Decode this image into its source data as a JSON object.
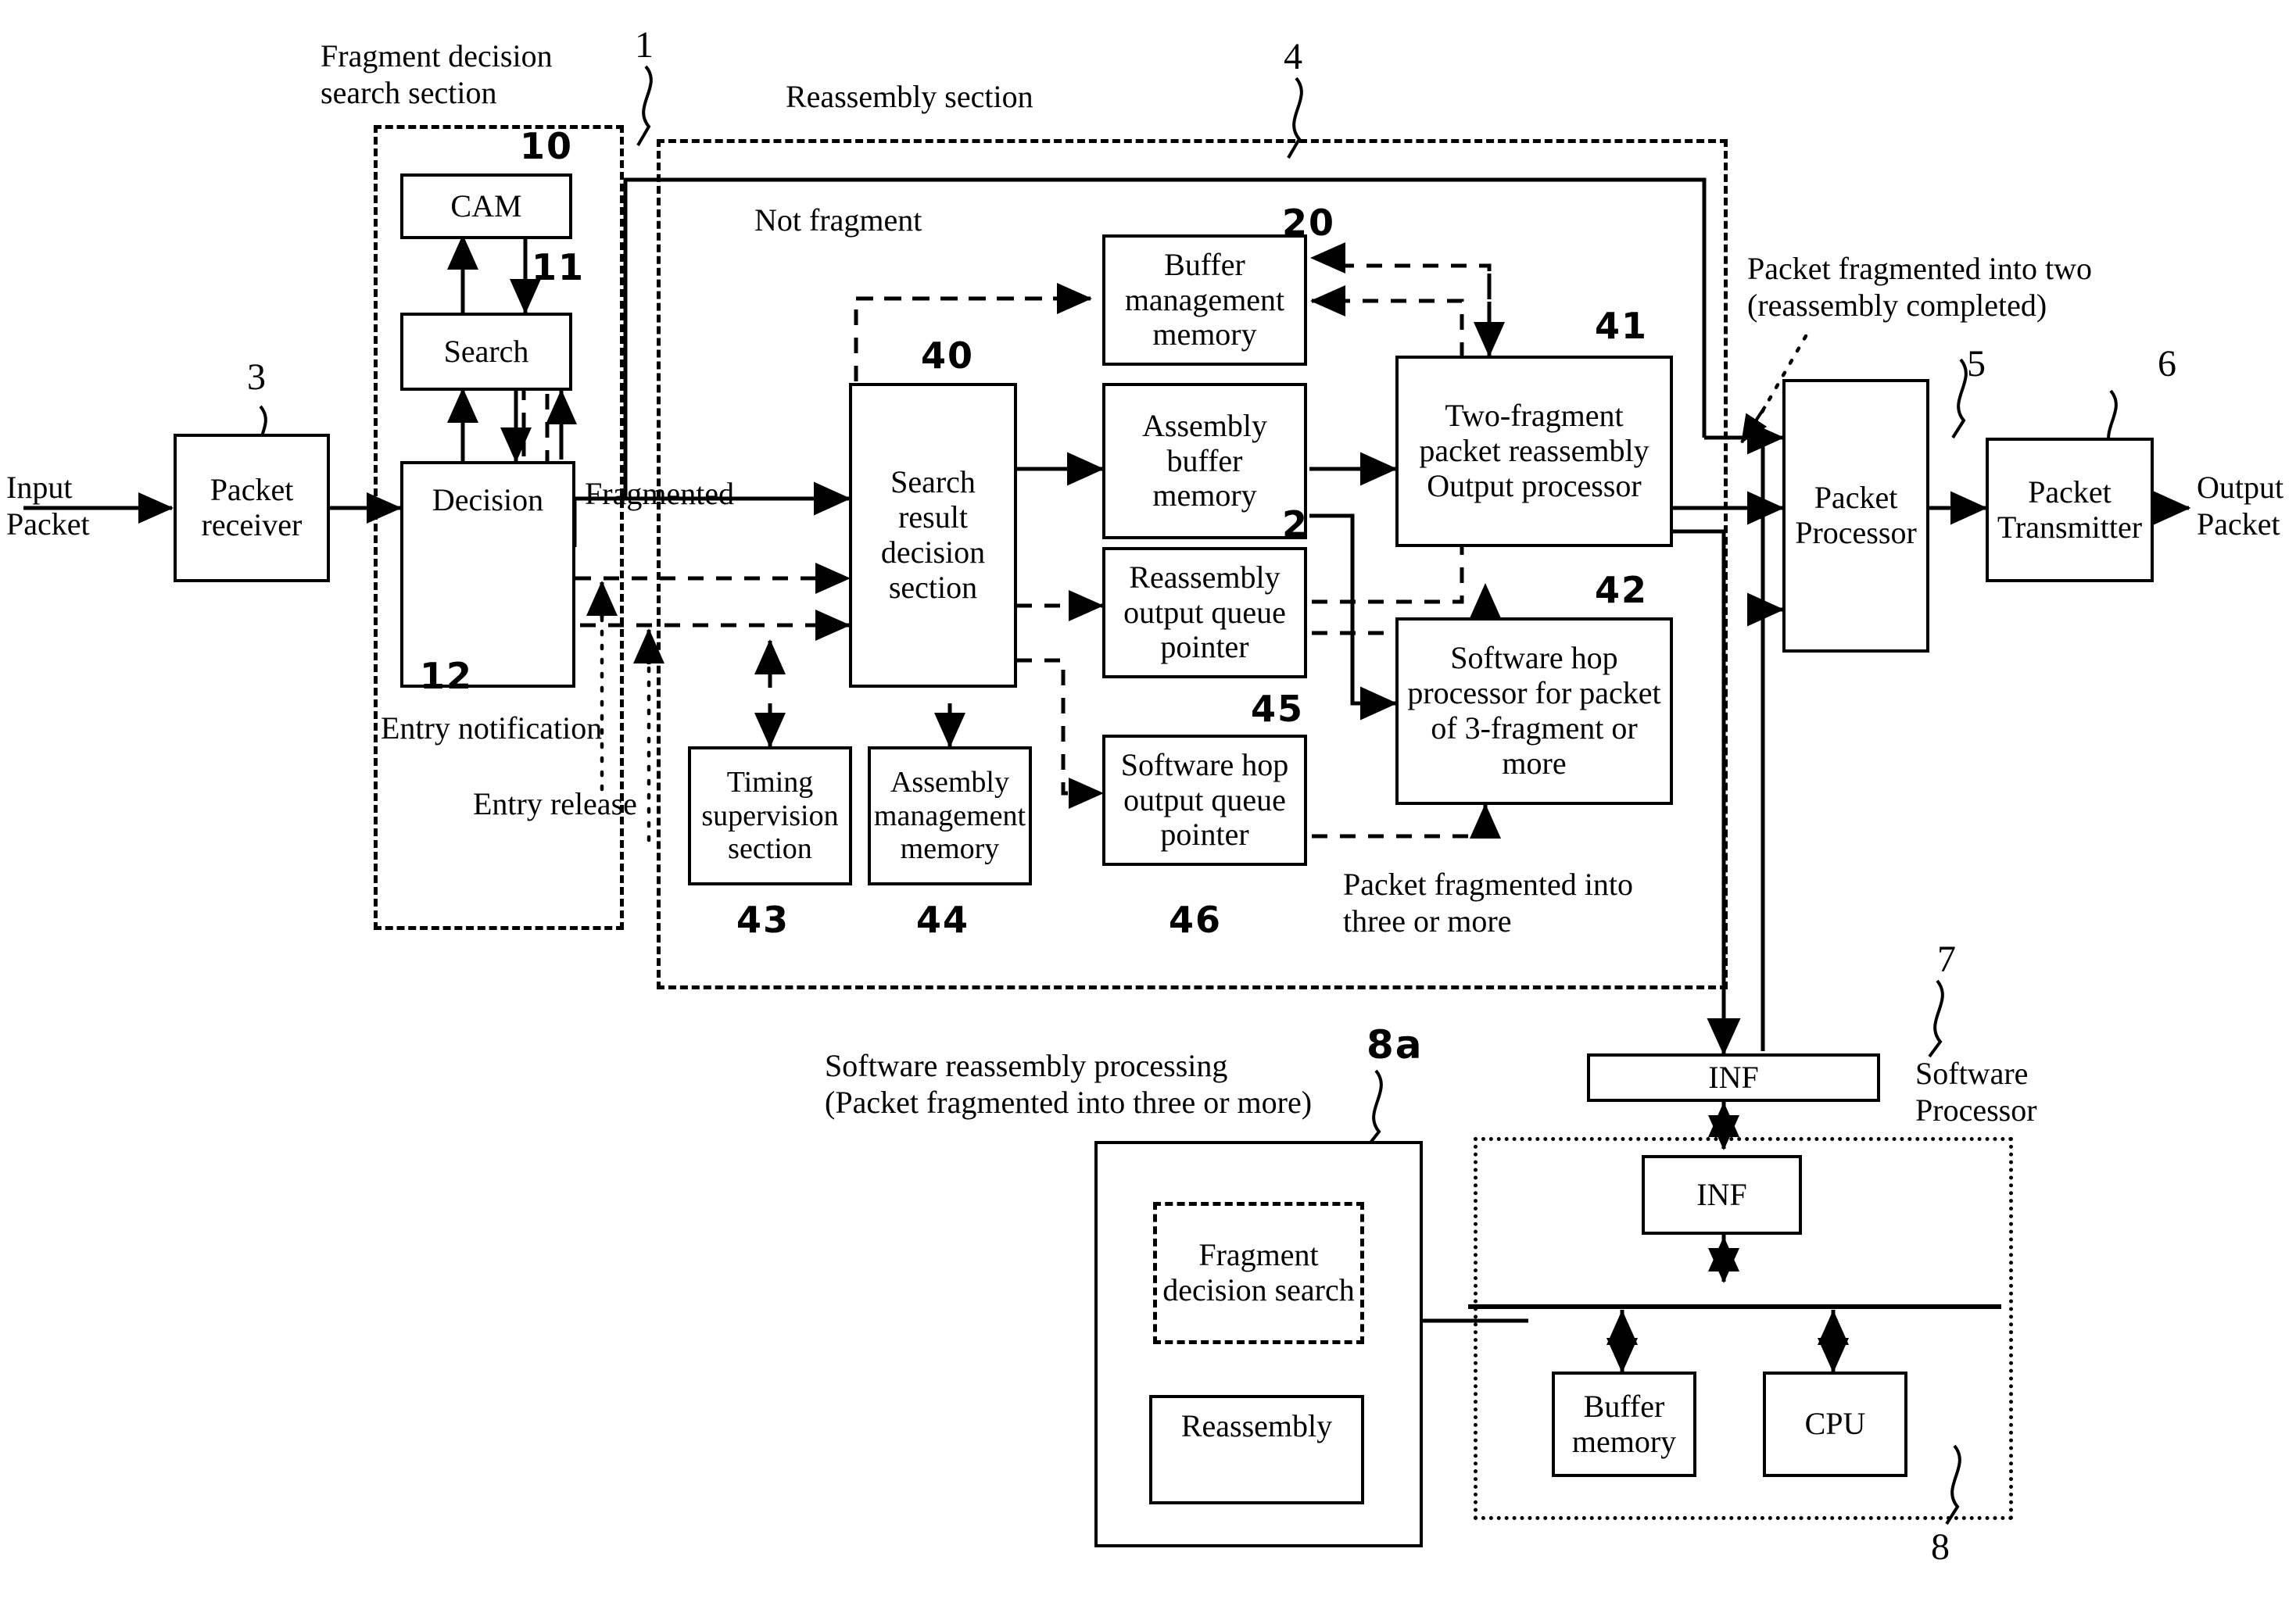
{
  "figure": {
    "title": "Packet reassembly apparatus block diagram",
    "io": {
      "input_label": "Input\nPacket",
      "output_label": "Output\nPacket"
    },
    "section_labels": {
      "fragment_decision_search": "Fragment decision\nsearch section",
      "reassembly_section": "Reassembly section",
      "software_processor": "Software\nProcessor",
      "software_reassembly_processing": "Software reassembly processing\n(Packet fragmented into three or more)"
    },
    "flow_labels": {
      "not_fragment": "Not fragment",
      "fragmented": "Fragmented",
      "entry_notification": "Entry notification",
      "entry_release": "Entry release",
      "packet_two": "Packet fragmented into two\n(reassembly completed)",
      "packet_three": "Packet fragmented into\nthree or more"
    },
    "blocks": [
      {
        "id": "packet-receiver",
        "label": "Packet\nreceiver",
        "ref": "3"
      },
      {
        "id": "cam",
        "label": "CAM",
        "ref": "10"
      },
      {
        "id": "search",
        "label": "Search",
        "ref": "11"
      },
      {
        "id": "decision",
        "label": "Decision",
        "ref": "12"
      },
      {
        "id": "search-result-decision-section",
        "label": "Search\nresult decision\nsection",
        "ref": "40"
      },
      {
        "id": "buffer-management-memory",
        "label": "Buffer\nmanagement\nmemory",
        "ref": "20"
      },
      {
        "id": "assembly-buffer-memory",
        "label": "Assembly\nbuffer\nmemory",
        "ref": "2"
      },
      {
        "id": "reassembly-output-queue-pointer",
        "label": "Reassembly\noutput queue\npointer",
        "ref": "45"
      },
      {
        "id": "software-hop-output-queue-pointer",
        "label": "Software hop\noutput queue\npointer",
        "ref": "46"
      },
      {
        "id": "timing-supervision-section",
        "label": "Timing\nsupervision\nsection",
        "ref": "43"
      },
      {
        "id": "assembly-management-memory",
        "label": "Assembly\nmanagement\nmemory",
        "ref": "44"
      },
      {
        "id": "two-fragment-packet-reassembly-output-processor",
        "label": "Two-fragment\npacket reassembly\nOutput processor",
        "ref": "41"
      },
      {
        "id": "software-hop-processor",
        "label": "Software hop\nprocessor for packet\nof 3-fragment or\nmore",
        "ref": "42"
      },
      {
        "id": "packet-processor",
        "label": "Packet\nProcessor",
        "ref": "5"
      },
      {
        "id": "packet-transmitter",
        "label": "Packet\nTransmitter",
        "ref": "6"
      },
      {
        "id": "inf-outer",
        "label": "INF",
        "ref": "7"
      },
      {
        "id": "inf-inner",
        "label": "INF",
        "ref": ""
      },
      {
        "id": "buffer-memory",
        "label": "Buffer\nmemory",
        "ref": ""
      },
      {
        "id": "cpu",
        "label": "CPU",
        "ref": "8"
      },
      {
        "id": "fragment-decision-search-sw",
        "label": "Fragment\ndecision search",
        "ref": ""
      },
      {
        "id": "reassembly-sw",
        "label": "Reassembly",
        "ref": "8a"
      }
    ],
    "reference_numerals": {
      "packet_receiver": "3",
      "fragment_decision_search_section": "1",
      "cam": "10",
      "search": "11",
      "decision": "12",
      "reassembly_section": "4",
      "search_result_decision_section": "40",
      "buffer_management_memory": "20",
      "assembly_buffer_memory": "2",
      "reassembly_output_queue_pointer": "45",
      "software_hop_output_queue_pointer": "46",
      "timing_supervision_section": "43",
      "assembly_management_memory": "44",
      "two_fragment_processor": "41",
      "software_hop_processor": "42",
      "packet_processor": "5",
      "packet_transmitter": "6",
      "inf": "7",
      "software_processor_inner": "8",
      "software_reassembly": "8a"
    }
  }
}
